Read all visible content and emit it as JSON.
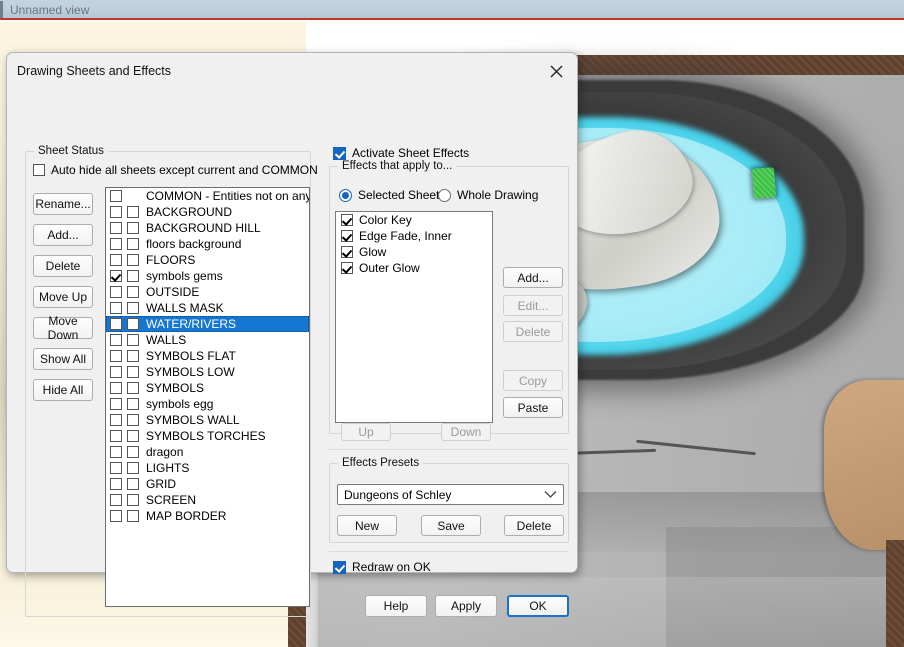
{
  "app": {
    "view_title": "Unnamed view"
  },
  "dialog": {
    "title": "Drawing Sheets and Effects",
    "close_icon": "close-icon"
  },
  "sheet_status": {
    "legend": "Sheet Status",
    "auto_hide": {
      "label": "Auto hide all sheets except current and COMMON",
      "checked": false
    },
    "buttons": [
      {
        "label": "Rename...",
        "enabled": true
      },
      {
        "label": "Add...",
        "enabled": true
      },
      {
        "label": "Delete",
        "enabled": true
      },
      {
        "label": "Move Up",
        "enabled": true
      },
      {
        "label": "Move Down",
        "enabled": true
      },
      {
        "label": "Show All",
        "enabled": true
      },
      {
        "label": "Hide All",
        "enabled": true
      }
    ],
    "sheets": [
      {
        "label": "COMMON - Entities not on any",
        "hide": false,
        "second": null,
        "selected": false
      },
      {
        "label": "BACKGROUND",
        "hide": false,
        "second": false,
        "selected": false
      },
      {
        "label": "BACKGROUND HILL",
        "hide": false,
        "second": false,
        "selected": false
      },
      {
        "label": "floors background",
        "hide": false,
        "second": false,
        "selected": false
      },
      {
        "label": "FLOORS",
        "hide": false,
        "second": false,
        "selected": false
      },
      {
        "label": "symbols gems",
        "hide": true,
        "second": false,
        "selected": false
      },
      {
        "label": "OUTSIDE",
        "hide": false,
        "second": false,
        "selected": false
      },
      {
        "label": "WALLS MASK",
        "hide": false,
        "second": false,
        "selected": false
      },
      {
        "label": "WATER/RIVERS",
        "hide": false,
        "second": false,
        "selected": true
      },
      {
        "label": "WALLS",
        "hide": false,
        "second": false,
        "selected": false
      },
      {
        "label": "SYMBOLS FLAT",
        "hide": false,
        "second": false,
        "selected": false
      },
      {
        "label": "SYMBOLS LOW",
        "hide": false,
        "second": false,
        "selected": false
      },
      {
        "label": "SYMBOLS",
        "hide": false,
        "second": false,
        "selected": false
      },
      {
        "label": "symbols egg",
        "hide": false,
        "second": false,
        "selected": false
      },
      {
        "label": "SYMBOLS WALL",
        "hide": false,
        "second": false,
        "selected": false
      },
      {
        "label": "SYMBOLS TORCHES",
        "hide": false,
        "second": false,
        "selected": false
      },
      {
        "label": "dragon",
        "hide": false,
        "second": false,
        "selected": false
      },
      {
        "label": "LIGHTS",
        "hide": false,
        "second": false,
        "selected": false
      },
      {
        "label": "GRID",
        "hide": false,
        "second": false,
        "selected": false
      },
      {
        "label": "SCREEN",
        "hide": false,
        "second": false,
        "selected": false
      },
      {
        "label": "MAP BORDER",
        "hide": false,
        "second": false,
        "selected": false
      }
    ]
  },
  "effects": {
    "activate": {
      "label": "Activate Sheet Effects",
      "checked": true
    },
    "apply_to_legend": "Effects that apply to...",
    "radio_selected_sheet": {
      "label": "Selected Sheet",
      "selected": true
    },
    "radio_whole_drawing": {
      "label": "Whole Drawing",
      "selected": false
    },
    "items": [
      {
        "label": "Color Key",
        "checked": true
      },
      {
        "label": "Edge Fade, Inner",
        "checked": true
      },
      {
        "label": "Glow",
        "checked": true
      },
      {
        "label": "Outer Glow",
        "checked": true
      }
    ],
    "side_buttons": [
      {
        "label": "Add...",
        "enabled": true
      },
      {
        "label": "Edit...",
        "enabled": false
      },
      {
        "label": "Delete",
        "enabled": false
      },
      {
        "label": "Copy",
        "enabled": false
      },
      {
        "label": "Paste",
        "enabled": true
      }
    ],
    "order_buttons": [
      {
        "label": "Up",
        "enabled": false
      },
      {
        "label": "Down",
        "enabled": false
      }
    ]
  },
  "presets": {
    "legend": "Effects Presets",
    "selected": "Dungeons of Schley",
    "buttons": [
      {
        "label": "New",
        "enabled": true
      },
      {
        "label": "Save",
        "enabled": true
      },
      {
        "label": "Delete",
        "enabled": true
      }
    ]
  },
  "footer": {
    "redraw_on_ok": {
      "label": "Redraw on OK",
      "checked": true
    },
    "buttons": [
      {
        "label": "Help",
        "enabled": true,
        "default": false
      },
      {
        "label": "Apply",
        "enabled": true,
        "default": false
      },
      {
        "label": "OK",
        "enabled": true,
        "default": true
      }
    ]
  },
  "colors": {
    "selection_blue": "#1577d2",
    "accent_blue": "#1565c0",
    "focus_border": "#1a73c8",
    "title_underline_red": "#c0392b",
    "pool_cyan": "#7fe8f7"
  }
}
